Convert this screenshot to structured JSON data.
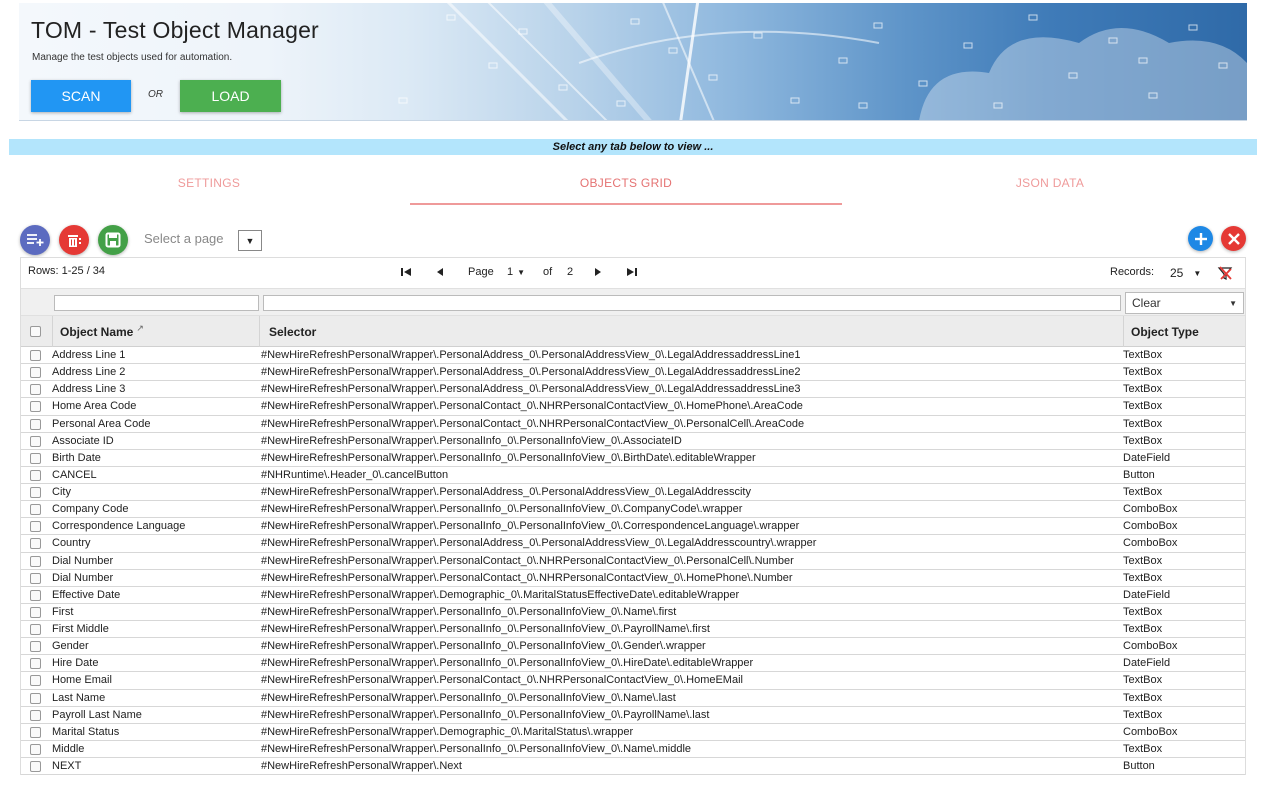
{
  "header": {
    "title": "TOM - Test Object Manager",
    "subtitle": "Manage the test objects used for automation.",
    "scan_label": "SCAN",
    "or_label": "OR",
    "load_label": "LOAD"
  },
  "info_strip": "Select any tab below to view ...",
  "tabs": [
    {
      "label": "SETTINGS",
      "active": false
    },
    {
      "label": "OBJECTS GRID",
      "active": true
    },
    {
      "label": "JSON DATA",
      "active": false
    }
  ],
  "toolbar": {
    "select_page_label": "Select a page",
    "select_page_arrow": "▼"
  },
  "pager": {
    "rows_info": "Rows: 1-25 / 34",
    "first_icon": "⏮",
    "prev_icon": "◀",
    "page_label": "Page",
    "page_value": "1",
    "dropdown_arrow": "▼",
    "of_label": "of",
    "total_pages": "2",
    "next_icon": "▶",
    "last_icon": "⏭",
    "records_label": "Records:",
    "records_value": "25"
  },
  "filter": {
    "clear_label": "Clear",
    "clear_arrow": "▼"
  },
  "columns": {
    "name": "Object Name",
    "name_sort_icon": "↗",
    "selector": "Selector",
    "type": "Object Type"
  },
  "rows": [
    {
      "name": "Address Line 1",
      "selector": "#NewHireRefreshPersonalWrapper\\.PersonalAddress_0\\.PersonalAddressView_0\\.LegalAddressaddressLine1",
      "type": "TextBox"
    },
    {
      "name": "Address Line 2",
      "selector": "#NewHireRefreshPersonalWrapper\\.PersonalAddress_0\\.PersonalAddressView_0\\.LegalAddressaddressLine2",
      "type": "TextBox"
    },
    {
      "name": "Address Line 3",
      "selector": "#NewHireRefreshPersonalWrapper\\.PersonalAddress_0\\.PersonalAddressView_0\\.LegalAddressaddressLine3",
      "type": "TextBox"
    },
    {
      "name": "Home Area Code",
      "selector": "#NewHireRefreshPersonalWrapper\\.PersonalContact_0\\.NHRPersonalContactView_0\\.HomePhone\\.AreaCode",
      "type": "TextBox"
    },
    {
      "name": "Personal Area Code",
      "selector": "#NewHireRefreshPersonalWrapper\\.PersonalContact_0\\.NHRPersonalContactView_0\\.PersonalCell\\.AreaCode",
      "type": "TextBox"
    },
    {
      "name": "Associate ID",
      "selector": "#NewHireRefreshPersonalWrapper\\.PersonalInfo_0\\.PersonalInfoView_0\\.AssociateID",
      "type": "TextBox"
    },
    {
      "name": "Birth Date",
      "selector": "#NewHireRefreshPersonalWrapper\\.PersonalInfo_0\\.PersonalInfoView_0\\.BirthDate\\.editableWrapper",
      "type": "DateField"
    },
    {
      "name": "CANCEL",
      "selector": "#NHRuntime\\.Header_0\\.cancelButton",
      "type": "Button"
    },
    {
      "name": "City",
      "selector": "#NewHireRefreshPersonalWrapper\\.PersonalAddress_0\\.PersonalAddressView_0\\.LegalAddresscity",
      "type": "TextBox"
    },
    {
      "name": "Company Code",
      "selector": "#NewHireRefreshPersonalWrapper\\.PersonalInfo_0\\.PersonalInfoView_0\\.CompanyCode\\.wrapper",
      "type": "ComboBox"
    },
    {
      "name": "Correspondence Language",
      "selector": "#NewHireRefreshPersonalWrapper\\.PersonalInfo_0\\.PersonalInfoView_0\\.CorrespondenceLanguage\\.wrapper",
      "type": "ComboBox"
    },
    {
      "name": "Country",
      "selector": "#NewHireRefreshPersonalWrapper\\.PersonalAddress_0\\.PersonalAddressView_0\\.LegalAddresscountry\\.wrapper",
      "type": "ComboBox"
    },
    {
      "name": "Dial Number",
      "selector": "#NewHireRefreshPersonalWrapper\\.PersonalContact_0\\.NHRPersonalContactView_0\\.PersonalCell\\.Number",
      "type": "TextBox"
    },
    {
      "name": "Dial Number",
      "selector": "#NewHireRefreshPersonalWrapper\\.PersonalContact_0\\.NHRPersonalContactView_0\\.HomePhone\\.Number",
      "type": "TextBox"
    },
    {
      "name": "Effective Date",
      "selector": "#NewHireRefreshPersonalWrapper\\.Demographic_0\\.MaritalStatusEffectiveDate\\.editableWrapper",
      "type": "DateField"
    },
    {
      "name": "First",
      "selector": "#NewHireRefreshPersonalWrapper\\.PersonalInfo_0\\.PersonalInfoView_0\\.Name\\.first",
      "type": "TextBox"
    },
    {
      "name": "First  Middle",
      "selector": "#NewHireRefreshPersonalWrapper\\.PersonalInfo_0\\.PersonalInfoView_0\\.PayrollName\\.first",
      "type": "TextBox"
    },
    {
      "name": "Gender",
      "selector": "#NewHireRefreshPersonalWrapper\\.PersonalInfo_0\\.PersonalInfoView_0\\.Gender\\.wrapper",
      "type": "ComboBox"
    },
    {
      "name": "Hire Date",
      "selector": "#NewHireRefreshPersonalWrapper\\.PersonalInfo_0\\.PersonalInfoView_0\\.HireDate\\.editableWrapper",
      "type": "DateField"
    },
    {
      "name": "Home Email",
      "selector": "#NewHireRefreshPersonalWrapper\\.PersonalContact_0\\.NHRPersonalContactView_0\\.HomeEMail",
      "type": "TextBox"
    },
    {
      "name": "Last Name",
      "selector": "#NewHireRefreshPersonalWrapper\\.PersonalInfo_0\\.PersonalInfoView_0\\.Name\\.last",
      "type": "TextBox"
    },
    {
      "name": "Payroll Last Name",
      "selector": "#NewHireRefreshPersonalWrapper\\.PersonalInfo_0\\.PersonalInfoView_0\\.PayrollName\\.last",
      "type": "TextBox"
    },
    {
      "name": "Marital Status",
      "selector": "#NewHireRefreshPersonalWrapper\\.Demographic_0\\.MaritalStatus\\.wrapper",
      "type": "ComboBox"
    },
    {
      "name": "Middle",
      "selector": "#NewHireRefreshPersonalWrapper\\.PersonalInfo_0\\.PersonalInfoView_0\\.Name\\.middle",
      "type": "TextBox"
    },
    {
      "name": "NEXT",
      "selector": "#NewHireRefreshPersonalWrapper\\.Next",
      "type": "Button"
    }
  ],
  "icons": {
    "add_row": "add-row-icon",
    "delete": "delete-icon",
    "save": "save-icon",
    "plus": "plus-icon",
    "close": "close-icon",
    "clear_filter": "clear-filter-icon"
  },
  "colors": {
    "scan": "#2196f3",
    "load": "#4caf50",
    "info_strip": "#b3e5fc",
    "tab_text": "#ef9a9a",
    "add_row": "#5c6bc0",
    "delete": "#e53935",
    "save": "#43a047",
    "plus": "#1e88e5"
  }
}
